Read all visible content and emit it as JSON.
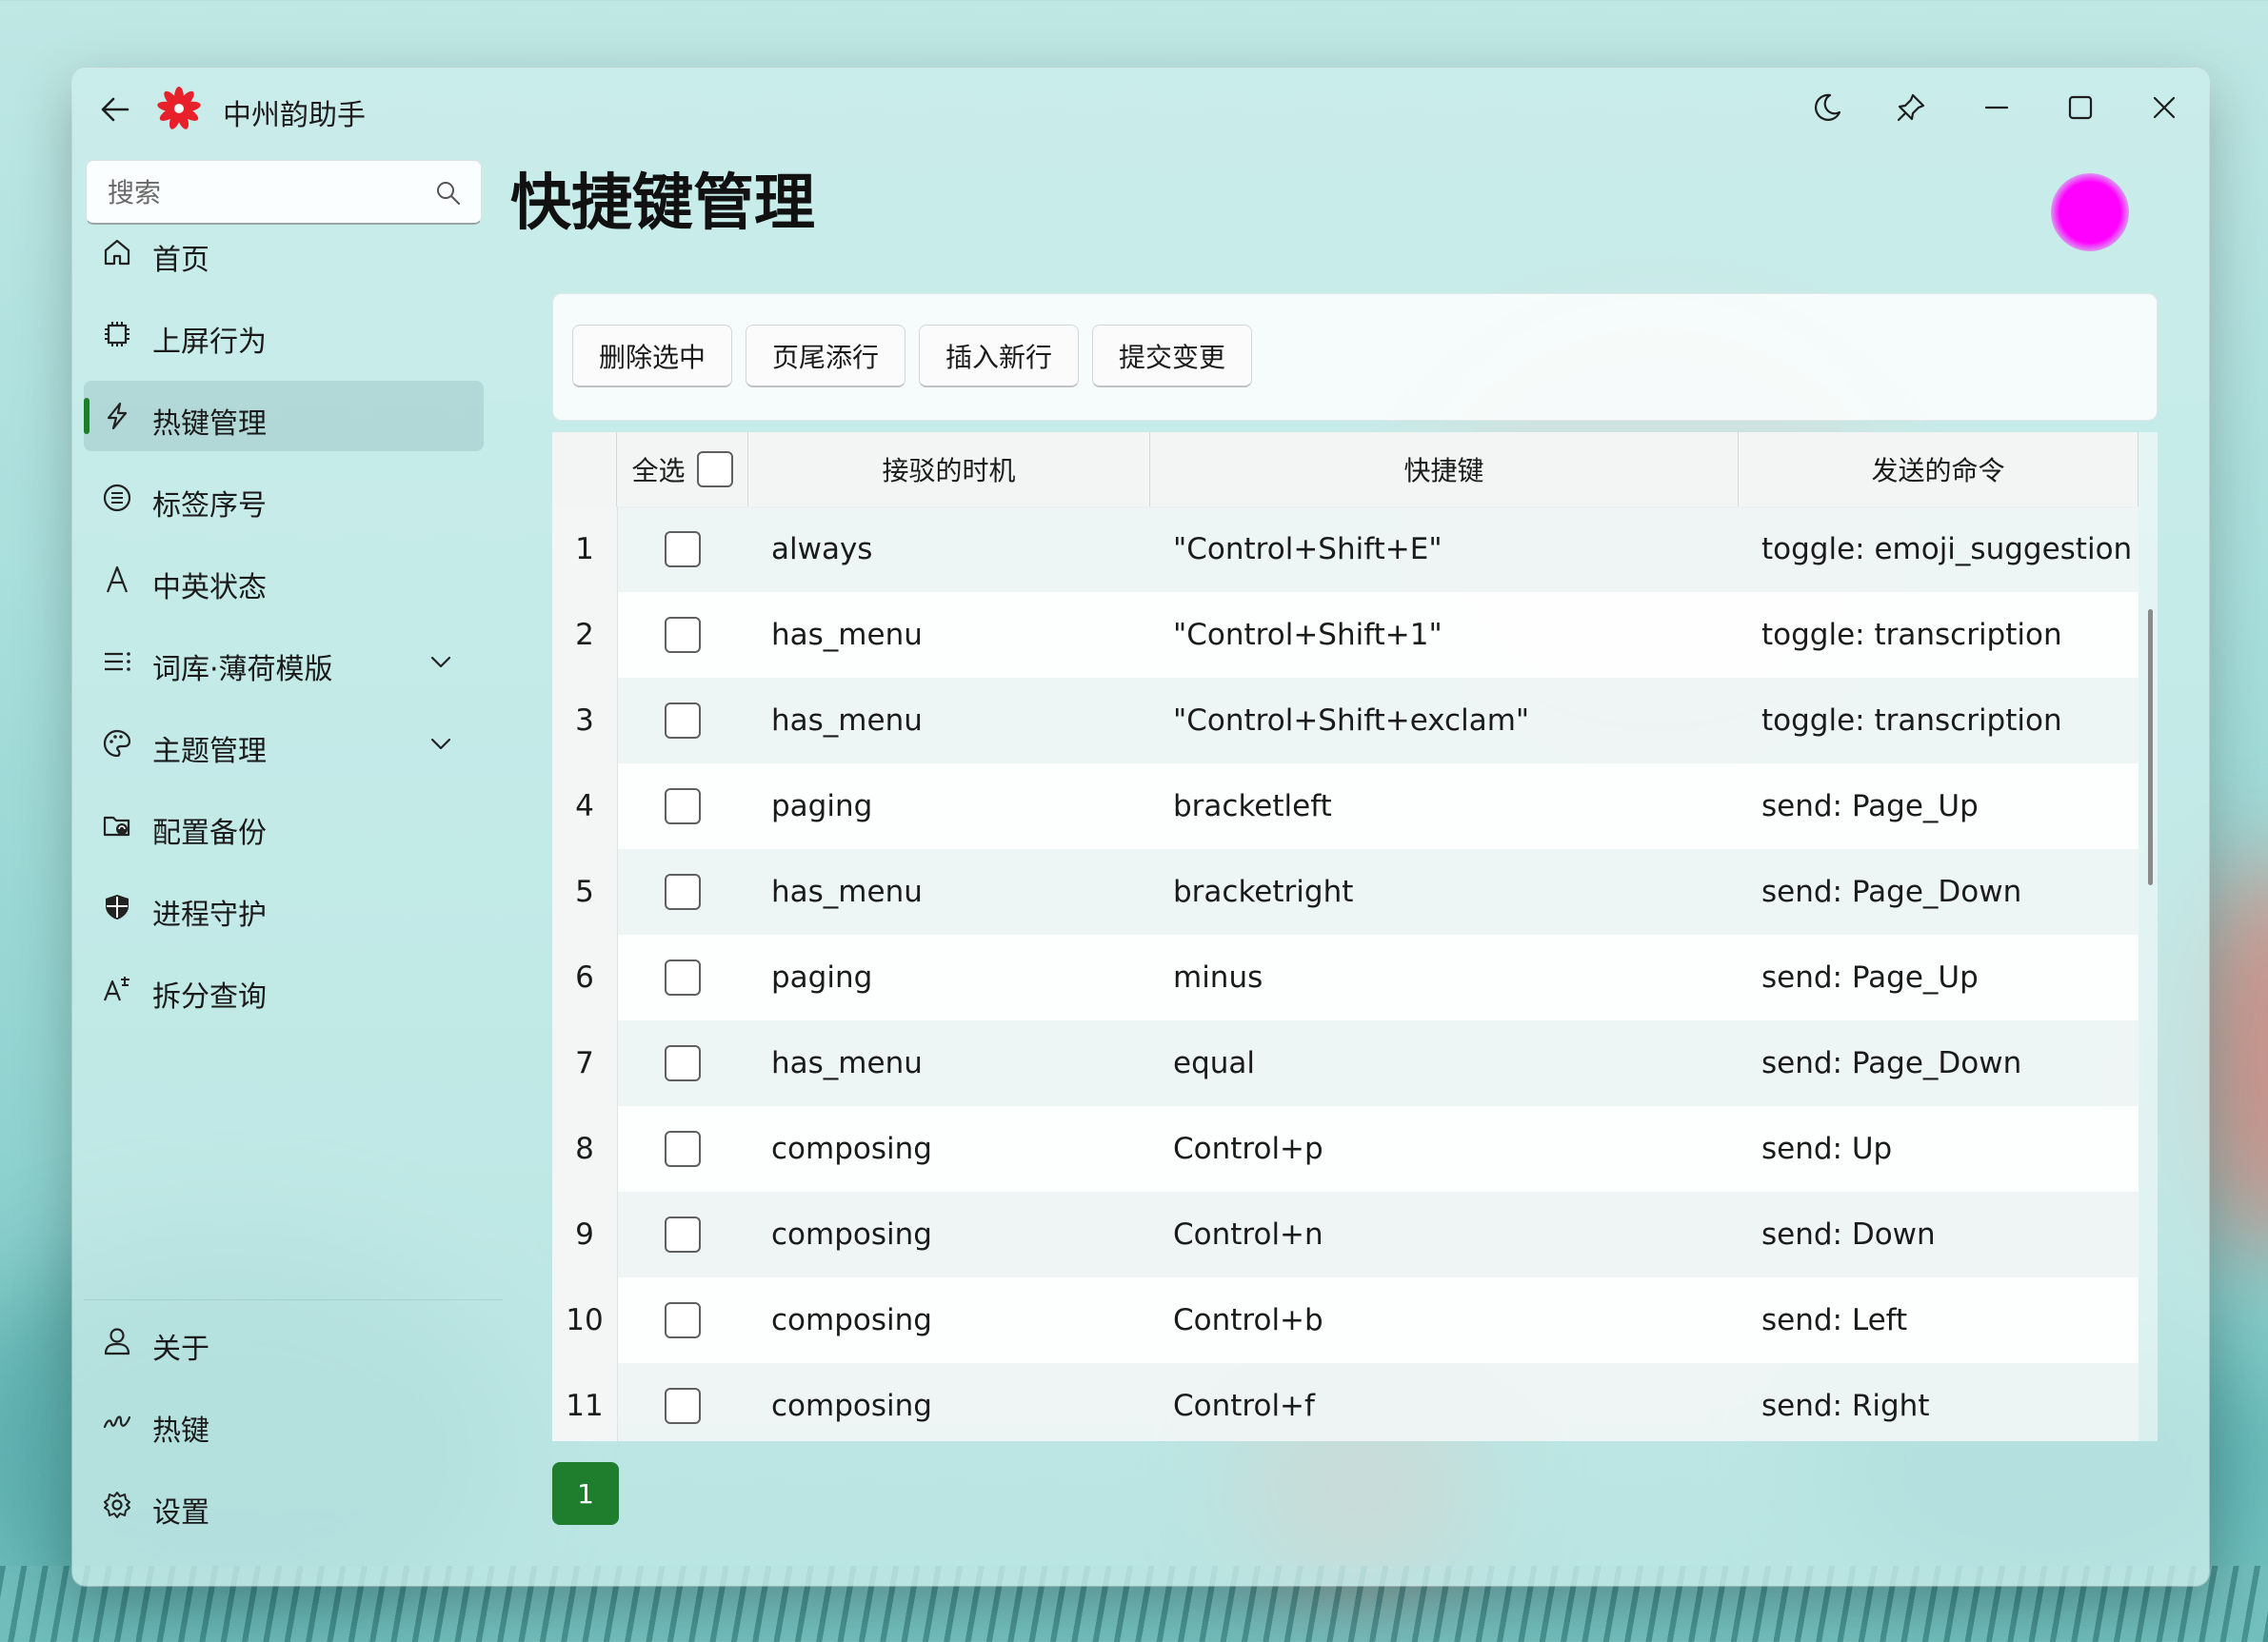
{
  "app": {
    "title": "中州韵助手"
  },
  "search": {
    "placeholder": "搜索"
  },
  "nav": {
    "items": [
      {
        "label": "首页",
        "icon": "home-icon"
      },
      {
        "label": "上屏行为",
        "icon": "chip-icon"
      },
      {
        "label": "热键管理",
        "icon": "lightning-icon",
        "active": true
      },
      {
        "label": "标签序号",
        "icon": "list-circle-icon"
      },
      {
        "label": "中英状态",
        "icon": "letter-a-icon"
      },
      {
        "label": "词库·薄荷模版",
        "icon": "bullet-list-icon",
        "expandable": true
      },
      {
        "label": "主题管理",
        "icon": "palette-icon",
        "expandable": true
      },
      {
        "label": "配置备份",
        "icon": "folder-sync-icon"
      },
      {
        "label": "进程守护",
        "icon": "shield-icon"
      },
      {
        "label": "拆分查询",
        "icon": "character-search-icon"
      }
    ],
    "footer": [
      {
        "label": "关于",
        "icon": "person-icon"
      },
      {
        "label": "热键",
        "icon": "gesture-icon"
      },
      {
        "label": "设置",
        "icon": "gear-icon"
      }
    ]
  },
  "page": {
    "title": "快捷键管理"
  },
  "toolbar": {
    "delete_label": "删除选中",
    "append_label": "页尾添行",
    "insert_label": "插入新行",
    "submit_label": "提交变更"
  },
  "table": {
    "select_all_label": "全选",
    "columns": [
      "接驳的时机",
      "快捷键",
      "发送的命令"
    ],
    "rows": [
      {
        "num": "1",
        "when": "always",
        "key": "\"Control+Shift+E\"",
        "cmd": "toggle: emoji_suggestion"
      },
      {
        "num": "2",
        "when": "has_menu",
        "key": "\"Control+Shift+1\"",
        "cmd": "toggle: transcription"
      },
      {
        "num": "3",
        "when": "has_menu",
        "key": "\"Control+Shift+exclam\"",
        "cmd": "toggle: transcription"
      },
      {
        "num": "4",
        "when": "paging",
        "key": "bracketleft",
        "cmd": "send: Page_Up"
      },
      {
        "num": "5",
        "when": "has_menu",
        "key": "bracketright",
        "cmd": "send: Page_Down"
      },
      {
        "num": "6",
        "when": "paging",
        "key": "minus",
        "cmd": "send: Page_Up"
      },
      {
        "num": "7",
        "when": "has_menu",
        "key": "equal",
        "cmd": "send: Page_Down"
      },
      {
        "num": "8",
        "when": "composing",
        "key": "Control+p",
        "cmd": "send: Up"
      },
      {
        "num": "9",
        "when": "composing",
        "key": "Control+n",
        "cmd": "send: Down"
      },
      {
        "num": "10",
        "when": "composing",
        "key": "Control+b",
        "cmd": "send: Left"
      },
      {
        "num": "11",
        "when": "composing",
        "key": "Control+f",
        "cmd": "send: Right"
      }
    ]
  },
  "pager": {
    "current": "1"
  },
  "colors": {
    "accent": "#1e7e2e",
    "avatar": "#ff00ff"
  }
}
